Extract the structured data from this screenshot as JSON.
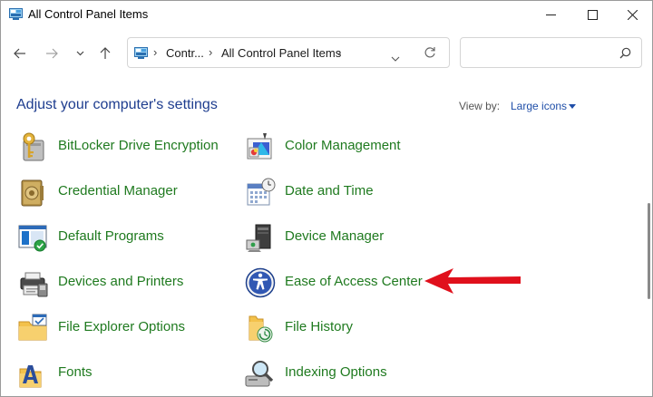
{
  "window": {
    "title": "All Control Panel Items"
  },
  "breadcrumb": {
    "root": "Contr...",
    "current": "All Control Panel Items"
  },
  "search": {
    "placeholder": ""
  },
  "header": {
    "title": "Adjust your computer's settings",
    "view_by_label": "View by:",
    "view_by_value": "Large icons"
  },
  "items": [
    {
      "label": "BitLocker Drive Encryption",
      "icon": "bitlocker-icon"
    },
    {
      "label": "Color Management",
      "icon": "color-management-icon"
    },
    {
      "label": "Credential Manager",
      "icon": "credential-manager-icon"
    },
    {
      "label": "Date and Time",
      "icon": "date-time-icon"
    },
    {
      "label": "Default Programs",
      "icon": "default-programs-icon"
    },
    {
      "label": "Device Manager",
      "icon": "device-manager-icon"
    },
    {
      "label": "Devices and Printers",
      "icon": "devices-printers-icon"
    },
    {
      "label": "Ease of Access Center",
      "icon": "ease-of-access-icon"
    },
    {
      "label": "File Explorer Options",
      "icon": "file-explorer-options-icon"
    },
    {
      "label": "File History",
      "icon": "file-history-icon"
    },
    {
      "label": "Fonts",
      "icon": "fonts-icon"
    },
    {
      "label": "Indexing Options",
      "icon": "indexing-options-icon"
    }
  ],
  "colors": {
    "link": "#1f7a1f",
    "header": "#1e3d8f",
    "annotation_arrow": "#e0101c"
  }
}
